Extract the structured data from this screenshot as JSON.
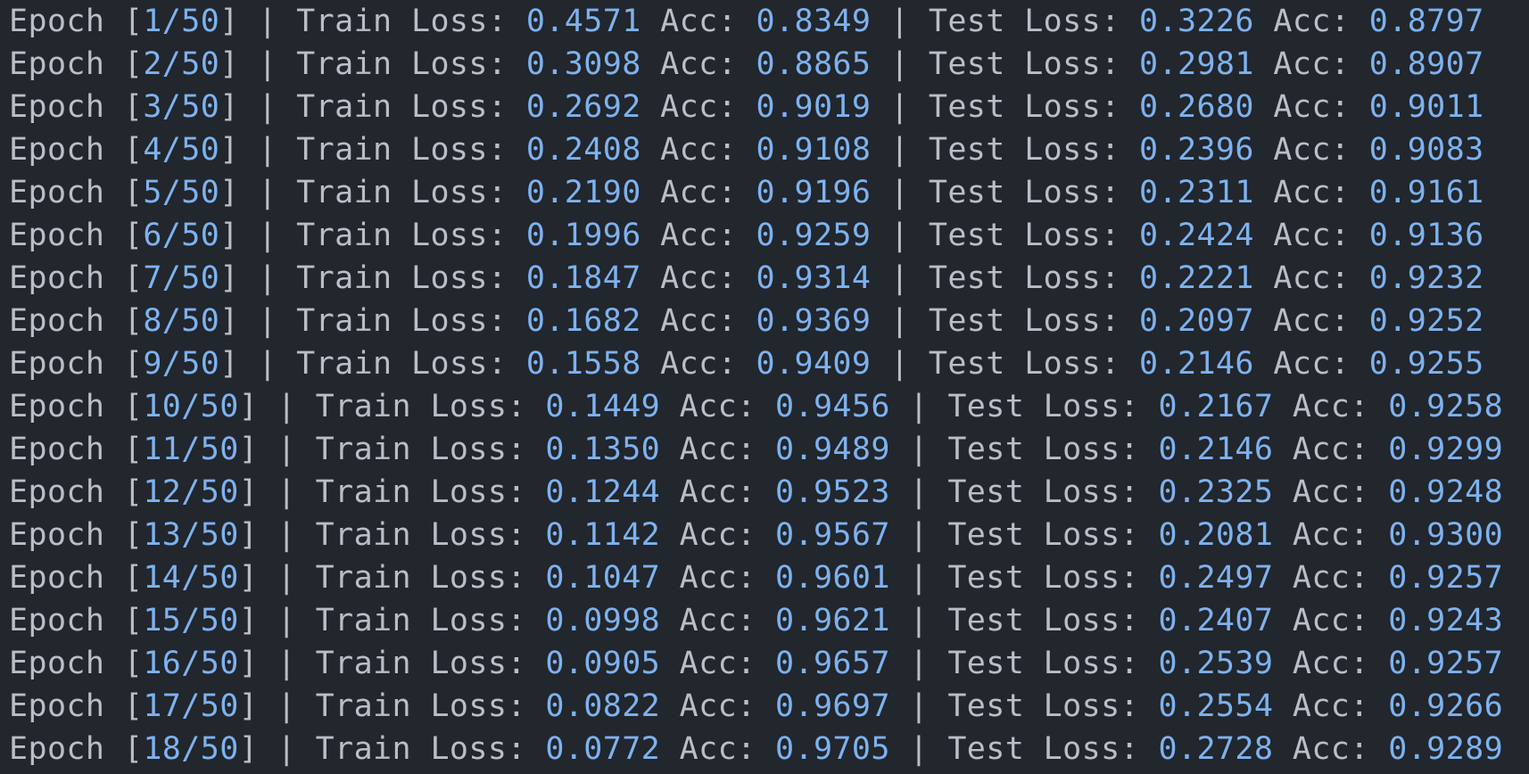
{
  "total_epochs": "50",
  "labels": {
    "epoch": "Epoch",
    "train_loss": "Train Loss:",
    "acc": "Acc:",
    "test_loss": "Test Loss:",
    "separator": "|"
  },
  "colors": {
    "background": "#22262d",
    "text": "#b9bec7",
    "number": "#7eb2ee"
  },
  "log": [
    {
      "epoch": "1",
      "train_loss": "0.4571",
      "train_acc": "0.8349",
      "test_loss": "0.3226",
      "test_acc": "0.8797"
    },
    {
      "epoch": "2",
      "train_loss": "0.3098",
      "train_acc": "0.8865",
      "test_loss": "0.2981",
      "test_acc": "0.8907"
    },
    {
      "epoch": "3",
      "train_loss": "0.2692",
      "train_acc": "0.9019",
      "test_loss": "0.2680",
      "test_acc": "0.9011"
    },
    {
      "epoch": "4",
      "train_loss": "0.2408",
      "train_acc": "0.9108",
      "test_loss": "0.2396",
      "test_acc": "0.9083"
    },
    {
      "epoch": "5",
      "train_loss": "0.2190",
      "train_acc": "0.9196",
      "test_loss": "0.2311",
      "test_acc": "0.9161"
    },
    {
      "epoch": "6",
      "train_loss": "0.1996",
      "train_acc": "0.9259",
      "test_loss": "0.2424",
      "test_acc": "0.9136"
    },
    {
      "epoch": "7",
      "train_loss": "0.1847",
      "train_acc": "0.9314",
      "test_loss": "0.2221",
      "test_acc": "0.9232"
    },
    {
      "epoch": "8",
      "train_loss": "0.1682",
      "train_acc": "0.9369",
      "test_loss": "0.2097",
      "test_acc": "0.9252"
    },
    {
      "epoch": "9",
      "train_loss": "0.1558",
      "train_acc": "0.9409",
      "test_loss": "0.2146",
      "test_acc": "0.9255"
    },
    {
      "epoch": "10",
      "train_loss": "0.1449",
      "train_acc": "0.9456",
      "test_loss": "0.2167",
      "test_acc": "0.9258"
    },
    {
      "epoch": "11",
      "train_loss": "0.1350",
      "train_acc": "0.9489",
      "test_loss": "0.2146",
      "test_acc": "0.9299"
    },
    {
      "epoch": "12",
      "train_loss": "0.1244",
      "train_acc": "0.9523",
      "test_loss": "0.2325",
      "test_acc": "0.9248"
    },
    {
      "epoch": "13",
      "train_loss": "0.1142",
      "train_acc": "0.9567",
      "test_loss": "0.2081",
      "test_acc": "0.9300"
    },
    {
      "epoch": "14",
      "train_loss": "0.1047",
      "train_acc": "0.9601",
      "test_loss": "0.2497",
      "test_acc": "0.9257"
    },
    {
      "epoch": "15",
      "train_loss": "0.0998",
      "train_acc": "0.9621",
      "test_loss": "0.2407",
      "test_acc": "0.9243"
    },
    {
      "epoch": "16",
      "train_loss": "0.0905",
      "train_acc": "0.9657",
      "test_loss": "0.2539",
      "test_acc": "0.9257"
    },
    {
      "epoch": "17",
      "train_loss": "0.0822",
      "train_acc": "0.9697",
      "test_loss": "0.2554",
      "test_acc": "0.9266"
    },
    {
      "epoch": "18",
      "train_loss": "0.0772",
      "train_acc": "0.9705",
      "test_loss": "0.2728",
      "test_acc": "0.9289"
    }
  ]
}
